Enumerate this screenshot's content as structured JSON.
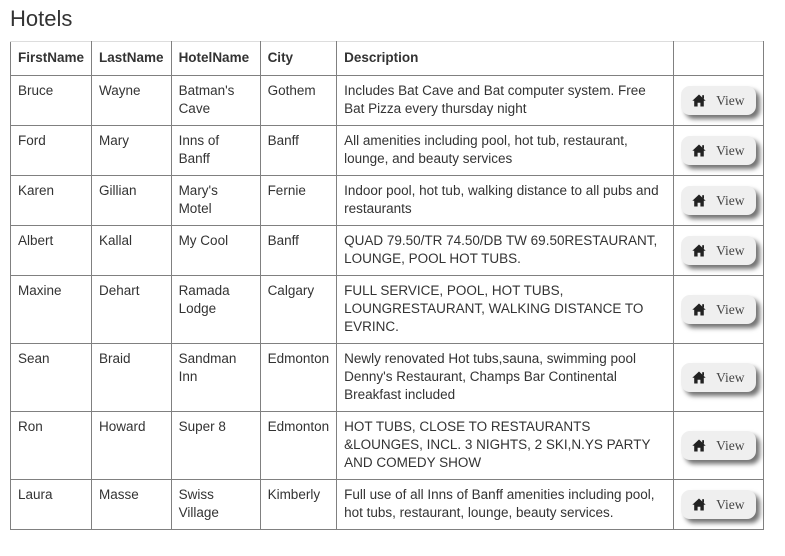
{
  "page": {
    "title": "Hotels"
  },
  "table": {
    "columns": [
      "FirstName",
      "LastName",
      "HotelName",
      "City",
      "Description",
      ""
    ],
    "action_label": "View",
    "action_icon": "home-icon",
    "rows": [
      {
        "first_name": "Bruce",
        "last_name": "Wayne",
        "hotel_name": "Batman's Cave",
        "city": "Gothem",
        "description": "Includes Bat Cave and Bat computer system. Free Bat Pizza every thursday night"
      },
      {
        "first_name": "Ford",
        "last_name": "Mary",
        "hotel_name": "Inns of Banff",
        "city": "Banff",
        "description": "All amenities including pool, hot tub, restaurant, lounge, and beauty services"
      },
      {
        "first_name": "Karen",
        "last_name": "Gillian",
        "hotel_name": "Mary's Motel",
        "city": "Fernie",
        "description": "Indoor pool, hot tub, walking distance to all pubs and restaurants"
      },
      {
        "first_name": "Albert",
        "last_name": "Kallal",
        "hotel_name": "My Cool",
        "city": "Banff",
        "description": "QUAD 79.50/TR 74.50/DB TW 69.50RESTAURANT, LOUNGE, POOL HOT TUBS."
      },
      {
        "first_name": "Maxine",
        "last_name": "Dehart",
        "hotel_name": "Ramada Lodge",
        "city": "Calgary",
        "description": "FULL SERVICE, POOL, HOT TUBS, LOUNGRESTAURANT, WALKING DISTANCE TO EVRINC."
      },
      {
        "first_name": "Sean",
        "last_name": "Braid",
        "hotel_name": "Sandman Inn",
        "city": "Edmonton",
        "description": "Newly renovated Hot tubs,sauna, swimming pool Denny's Restaurant, Champs Bar Continental Breakfast included"
      },
      {
        "first_name": "Ron",
        "last_name": "Howard",
        "hotel_name": "Super 8",
        "city": "Edmonton",
        "description": "HOT TUBS, CLOSE TO RESTAURANTS &LOUNGES, INCL. 3 NIGHTS, 2 SKI,N.YS PARTY AND COMEDY SHOW"
      },
      {
        "first_name": "Laura",
        "last_name": "Masse",
        "hotel_name": "Swiss Village",
        "city": "Kimberly",
        "description": "Full use of all Inns of Banff amenities including pool, hot tubs, restaurant, lounge, beauty services."
      }
    ]
  }
}
